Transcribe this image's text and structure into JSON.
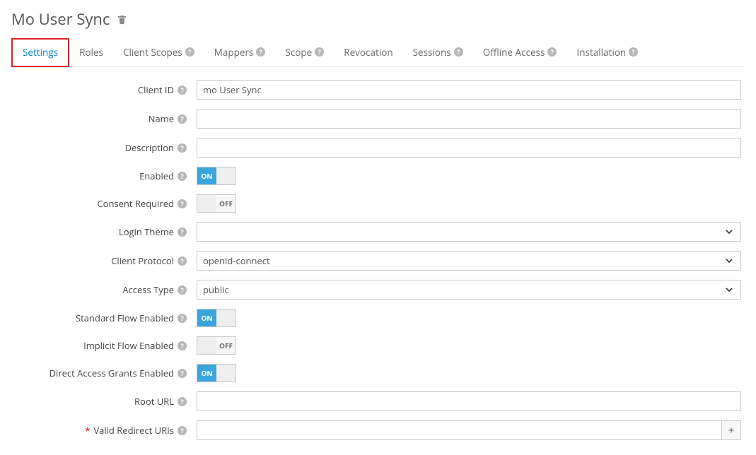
{
  "page": {
    "title": "Mo User Sync"
  },
  "tabs": [
    {
      "label": "Settings",
      "help": false,
      "active": true
    },
    {
      "label": "Roles",
      "help": false,
      "active": false
    },
    {
      "label": "Client Scopes",
      "help": true,
      "active": false
    },
    {
      "label": "Mappers",
      "help": true,
      "active": false
    },
    {
      "label": "Scope",
      "help": true,
      "active": false
    },
    {
      "label": "Revocation",
      "help": false,
      "active": false
    },
    {
      "label": "Sessions",
      "help": true,
      "active": false
    },
    {
      "label": "Offline Access",
      "help": true,
      "active": false
    },
    {
      "label": "Installation",
      "help": true,
      "active": false
    }
  ],
  "labels": {
    "client_id": "Client ID",
    "name": "Name",
    "description": "Description",
    "enabled": "Enabled",
    "consent_required": "Consent Required",
    "login_theme": "Login Theme",
    "client_protocol": "Client Protocol",
    "access_type": "Access Type",
    "standard_flow": "Standard Flow Enabled",
    "implicit_flow": "Implicit Flow Enabled",
    "direct_access": "Direct Access Grants Enabled",
    "root_url": "Root URL",
    "valid_redirect": "Valid Redirect URIs"
  },
  "values": {
    "client_id": "mo User Sync",
    "name": "",
    "description": "",
    "login_theme": "",
    "client_protocol": "openid-connect",
    "access_type": "public",
    "root_url": "",
    "valid_redirect": ""
  },
  "toggles": {
    "enabled": "ON",
    "consent_required": "OFF",
    "standard_flow": "ON",
    "implicit_flow": "OFF",
    "direct_access": "ON"
  },
  "toggle_text": {
    "on": "ON",
    "off": "OFF"
  },
  "glyphs": {
    "help": "?",
    "plus": "+",
    "required": "*"
  }
}
